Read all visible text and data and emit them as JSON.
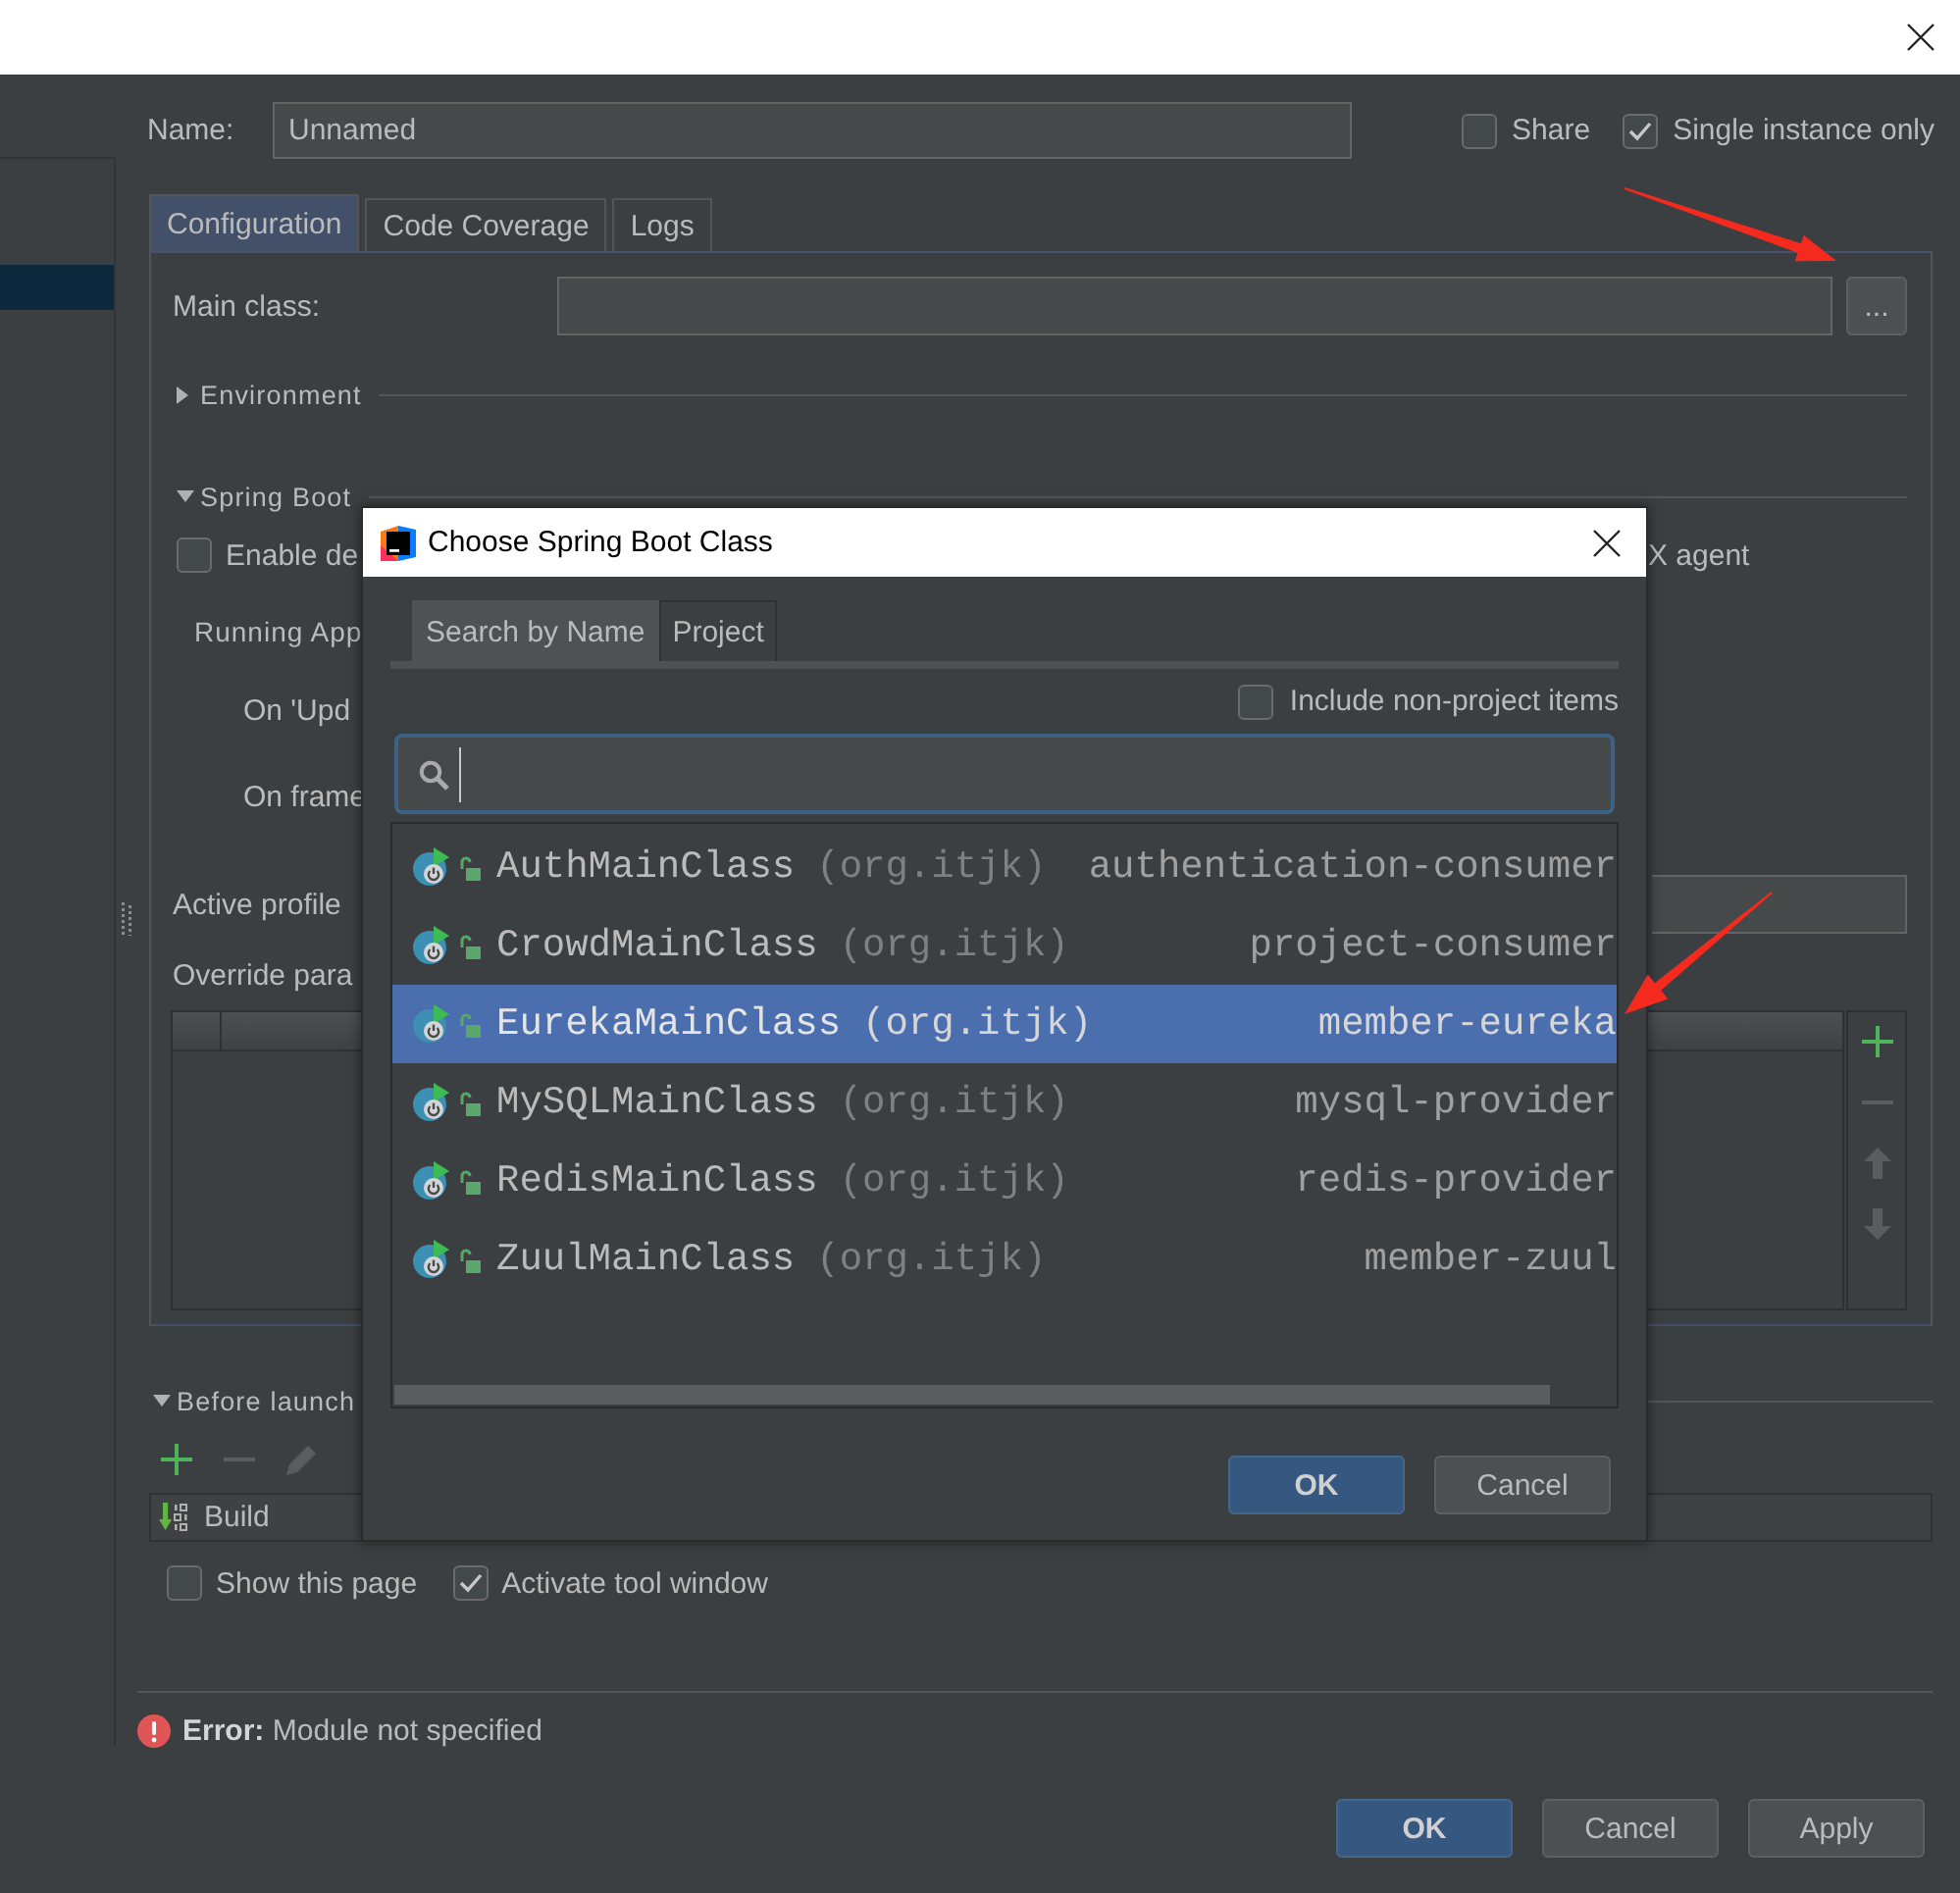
{
  "sidebar": {
    "items": [
      {
        "selected": true
      }
    ]
  },
  "name": {
    "label": "Name:",
    "value": "Unnamed"
  },
  "options": [
    {
      "label": "Share",
      "checked": false
    },
    {
      "label": "Single instance only",
      "checked": true
    }
  ],
  "tabs": [
    {
      "label": "Configuration",
      "selected": true
    },
    {
      "label": "Code Coverage",
      "selected": false
    },
    {
      "label": "Logs",
      "selected": false
    }
  ],
  "configuration": {
    "main_class": {
      "label": "Main class:",
      "browse_button": "..."
    },
    "environment": {
      "label": "Environment",
      "expanded": false
    },
    "spring_boot": {
      "label": "Spring Boot",
      "expanded": true,
      "enable_option": {
        "label": "Enable de",
        "checked": false
      },
      "agent_option": {
        "label": "X agent"
      },
      "running_app": {
        "label": "Running App"
      },
      "on_update": {
        "label": "On 'Upd"
      },
      "on_frame": {
        "label": "On frame"
      }
    },
    "active_profile": {
      "label": "Active profile"
    },
    "override_table": {
      "label": "Override para",
      "toolbar": [
        {
          "kind": "add",
          "disabled": false
        },
        {
          "kind": "remove",
          "disabled": true
        },
        {
          "kind": "up",
          "disabled": true
        },
        {
          "kind": "down",
          "disabled": true
        }
      ]
    }
  },
  "before_launch": {
    "label": "Before launch",
    "expanded": true,
    "toolbar": [
      {
        "kind": "add",
        "disabled": false
      },
      {
        "kind": "remove",
        "disabled": true
      },
      {
        "kind": "edit",
        "disabled": true
      }
    ],
    "tasks": [
      {
        "label": "Build"
      }
    ]
  },
  "launch_options": [
    {
      "label": "Show this page",
      "checked": false
    },
    {
      "label": "Activate tool window",
      "checked": true
    }
  ],
  "error": "**Error:** Module not specified",
  "buttons": [
    {
      "label": "OK",
      "kind": "primary"
    },
    {
      "label": "Cancel",
      "kind": "secondary"
    },
    {
      "label": "Apply",
      "kind": "secondary"
    }
  ],
  "dialog": {
    "title": "Choose Spring Boot Class",
    "tabs": [
      {
        "label": "Search by Name",
        "selected": true
      },
      {
        "label": "Project",
        "selected": false
      }
    ],
    "include_non_project": {
      "label": "Include non-project items",
      "checked": false
    },
    "classes": [
      {
        "name": "AuthMainClass",
        "package": "(org.itjk)",
        "module": "authentication-consumer",
        "selected": false
      },
      {
        "name": "CrowdMainClass",
        "package": "(org.itjk)",
        "module": "project-consumer",
        "selected": false
      },
      {
        "name": "EurekaMainClass",
        "package": "(org.itjk)",
        "module": "member-eureka",
        "selected": true
      },
      {
        "name": "MySQLMainClass",
        "package": "(org.itjk)",
        "module": "mysql-provider",
        "selected": false
      },
      {
        "name": "RedisMainClass",
        "package": "(org.itjk)",
        "module": "redis-provider",
        "selected": false
      },
      {
        "name": "ZuulMainClass",
        "package": "(org.itjk)",
        "module": "member-zuul",
        "selected": false
      }
    ],
    "buttons": [
      {
        "label": "OK",
        "kind": "primary"
      },
      {
        "label": "Cancel",
        "kind": "secondary"
      }
    ]
  }
}
